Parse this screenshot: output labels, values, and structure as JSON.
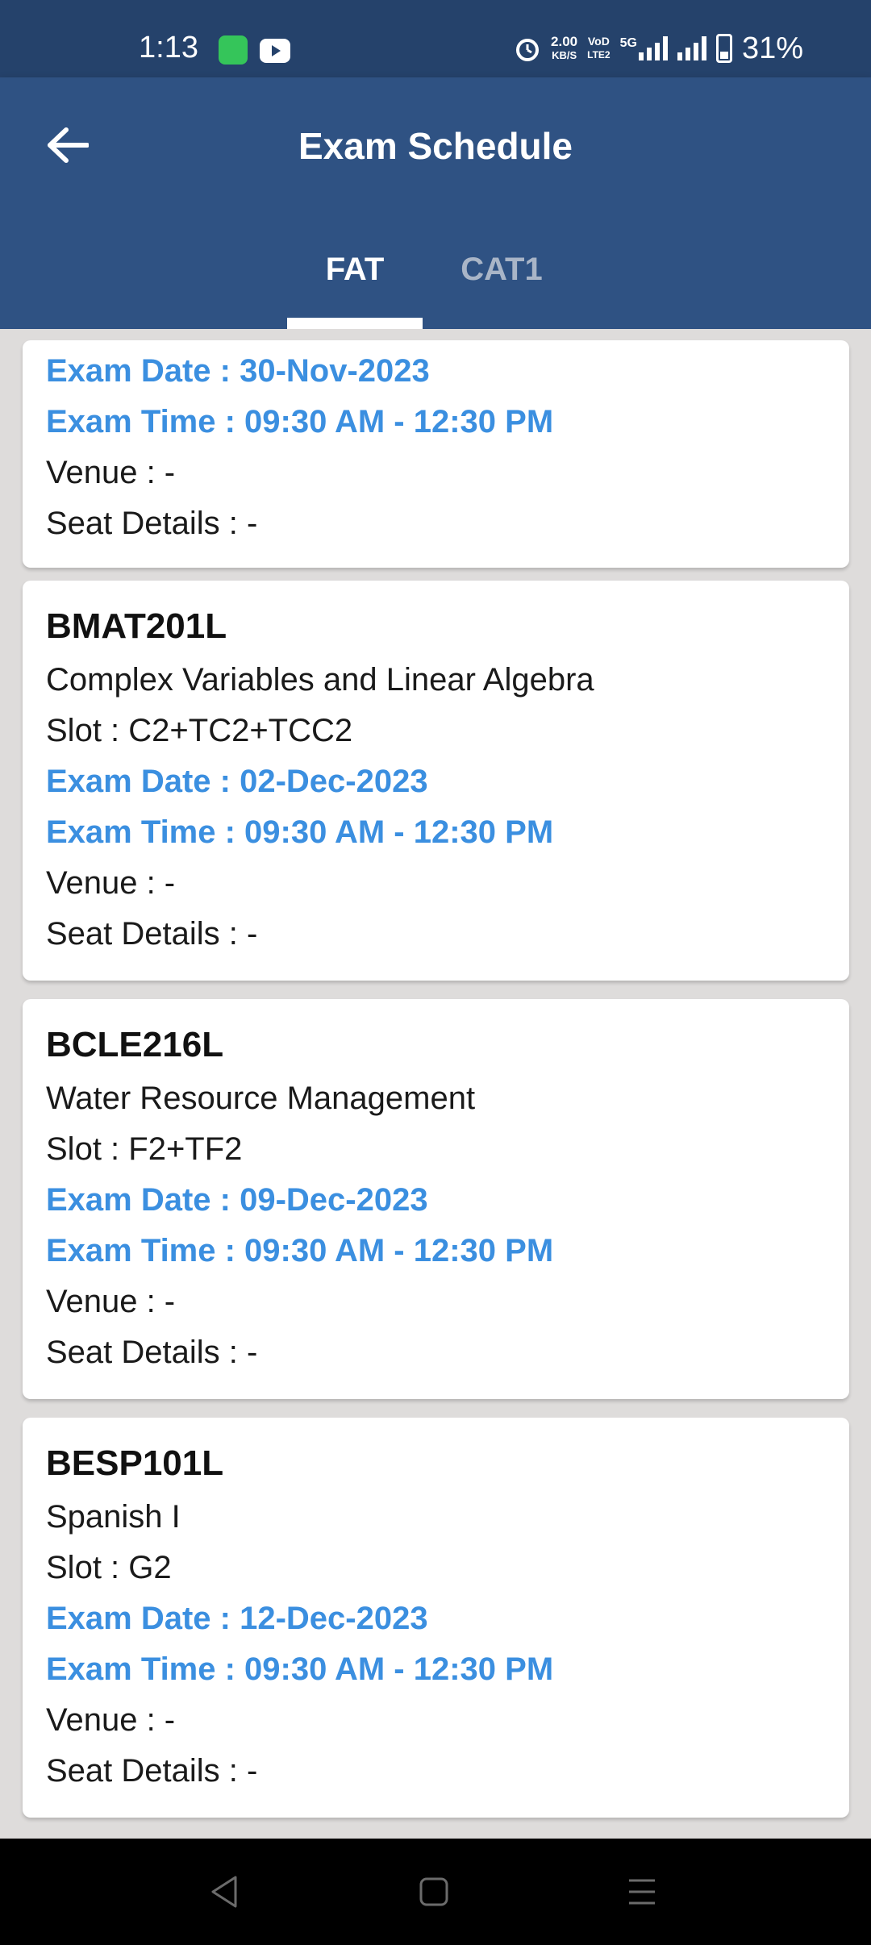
{
  "status_bar": {
    "time": "1:13",
    "net_speed_top": "2.00",
    "net_speed_bottom": "KB/S",
    "volte_top": "VoD",
    "volte_bottom": "LTE2",
    "network": "5G",
    "battery": "31%"
  },
  "app_bar": {
    "title": "Exam Schedule",
    "back_icon": "arrow-left-icon"
  },
  "tabs": [
    {
      "label": "FAT",
      "active": true
    },
    {
      "label": "CAT1",
      "active": false
    }
  ],
  "cards": [
    {
      "exam_date": "Exam Date : 30-Nov-2023",
      "exam_time": "Exam Time : 09:30 AM - 12:30 PM",
      "venue": "Venue : -",
      "seat": "Seat Details : -"
    },
    {
      "code": "BMAT201L",
      "title": "Complex Variables and Linear Algebra",
      "slot": "Slot : C2+TC2+TCC2",
      "exam_date": "Exam Date : 02-Dec-2023",
      "exam_time": "Exam Time : 09:30 AM - 12:30 PM",
      "venue": "Venue : -",
      "seat": "Seat Details : -"
    },
    {
      "code": "BCLE216L",
      "title": "Water Resource Management",
      "slot": "Slot : F2+TF2",
      "exam_date": "Exam Date : 09-Dec-2023",
      "exam_time": "Exam Time : 09:30 AM - 12:30 PM",
      "venue": "Venue : -",
      "seat": "Seat Details : -"
    },
    {
      "code": "BESP101L",
      "title": "Spanish I",
      "slot": "Slot : G2",
      "exam_date": "Exam Date : 12-Dec-2023",
      "exam_time": "Exam Time : 09:30 AM - 12:30 PM",
      "venue": "Venue : -",
      "seat": "Seat Details : -"
    }
  ],
  "colors": {
    "status_bar": "#25426b",
    "app_bar": "#2f5283",
    "accent_blue": "#3b8fe0",
    "background": "#dedcdb"
  }
}
